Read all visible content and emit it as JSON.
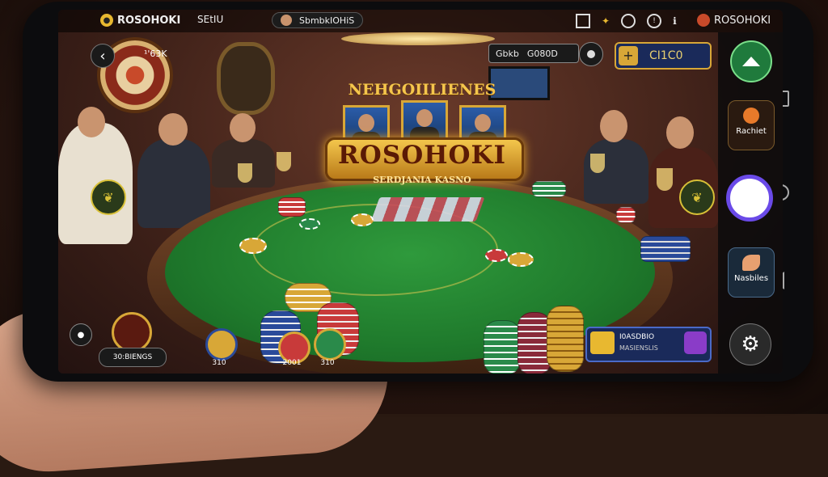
{
  "status": {
    "brand": "ROSOHOKI",
    "menu": "SEtIU",
    "user_label": "SbmbkIOHiS",
    "right_brand": "ROSOHOKI"
  },
  "hud": {
    "back_label": "‹",
    "score_label": "¹'63K",
    "balance_prefix": "Gbkb",
    "balance_value": "G080D",
    "coin_value": "CI1C0"
  },
  "logo": {
    "top_text": "NEHGOIILIENES",
    "main_text": "ROSOHOKI",
    "sub_text": "SERDJANIA KASNO"
  },
  "side": {
    "home_label": "",
    "item1_label": "Rachiet",
    "item2_label": "Nasbiles"
  },
  "bottom": {
    "player_label": "30:BIENGS",
    "chip_labels": [
      "310",
      "2001",
      "310"
    ],
    "banner_line1": "I0ASDBIO",
    "banner_line2": "MASIENSLIS"
  },
  "icons": {
    "leaf_left": "leaf-icon",
    "leaf_right": "leaf-icon",
    "settings": "gear-icon",
    "home": "home-icon"
  },
  "colors": {
    "felt": "#1f7a2c",
    "gold": "#d8a737",
    "accent_purple": "#7a3cc8",
    "panel": "#0a0a0c"
  }
}
